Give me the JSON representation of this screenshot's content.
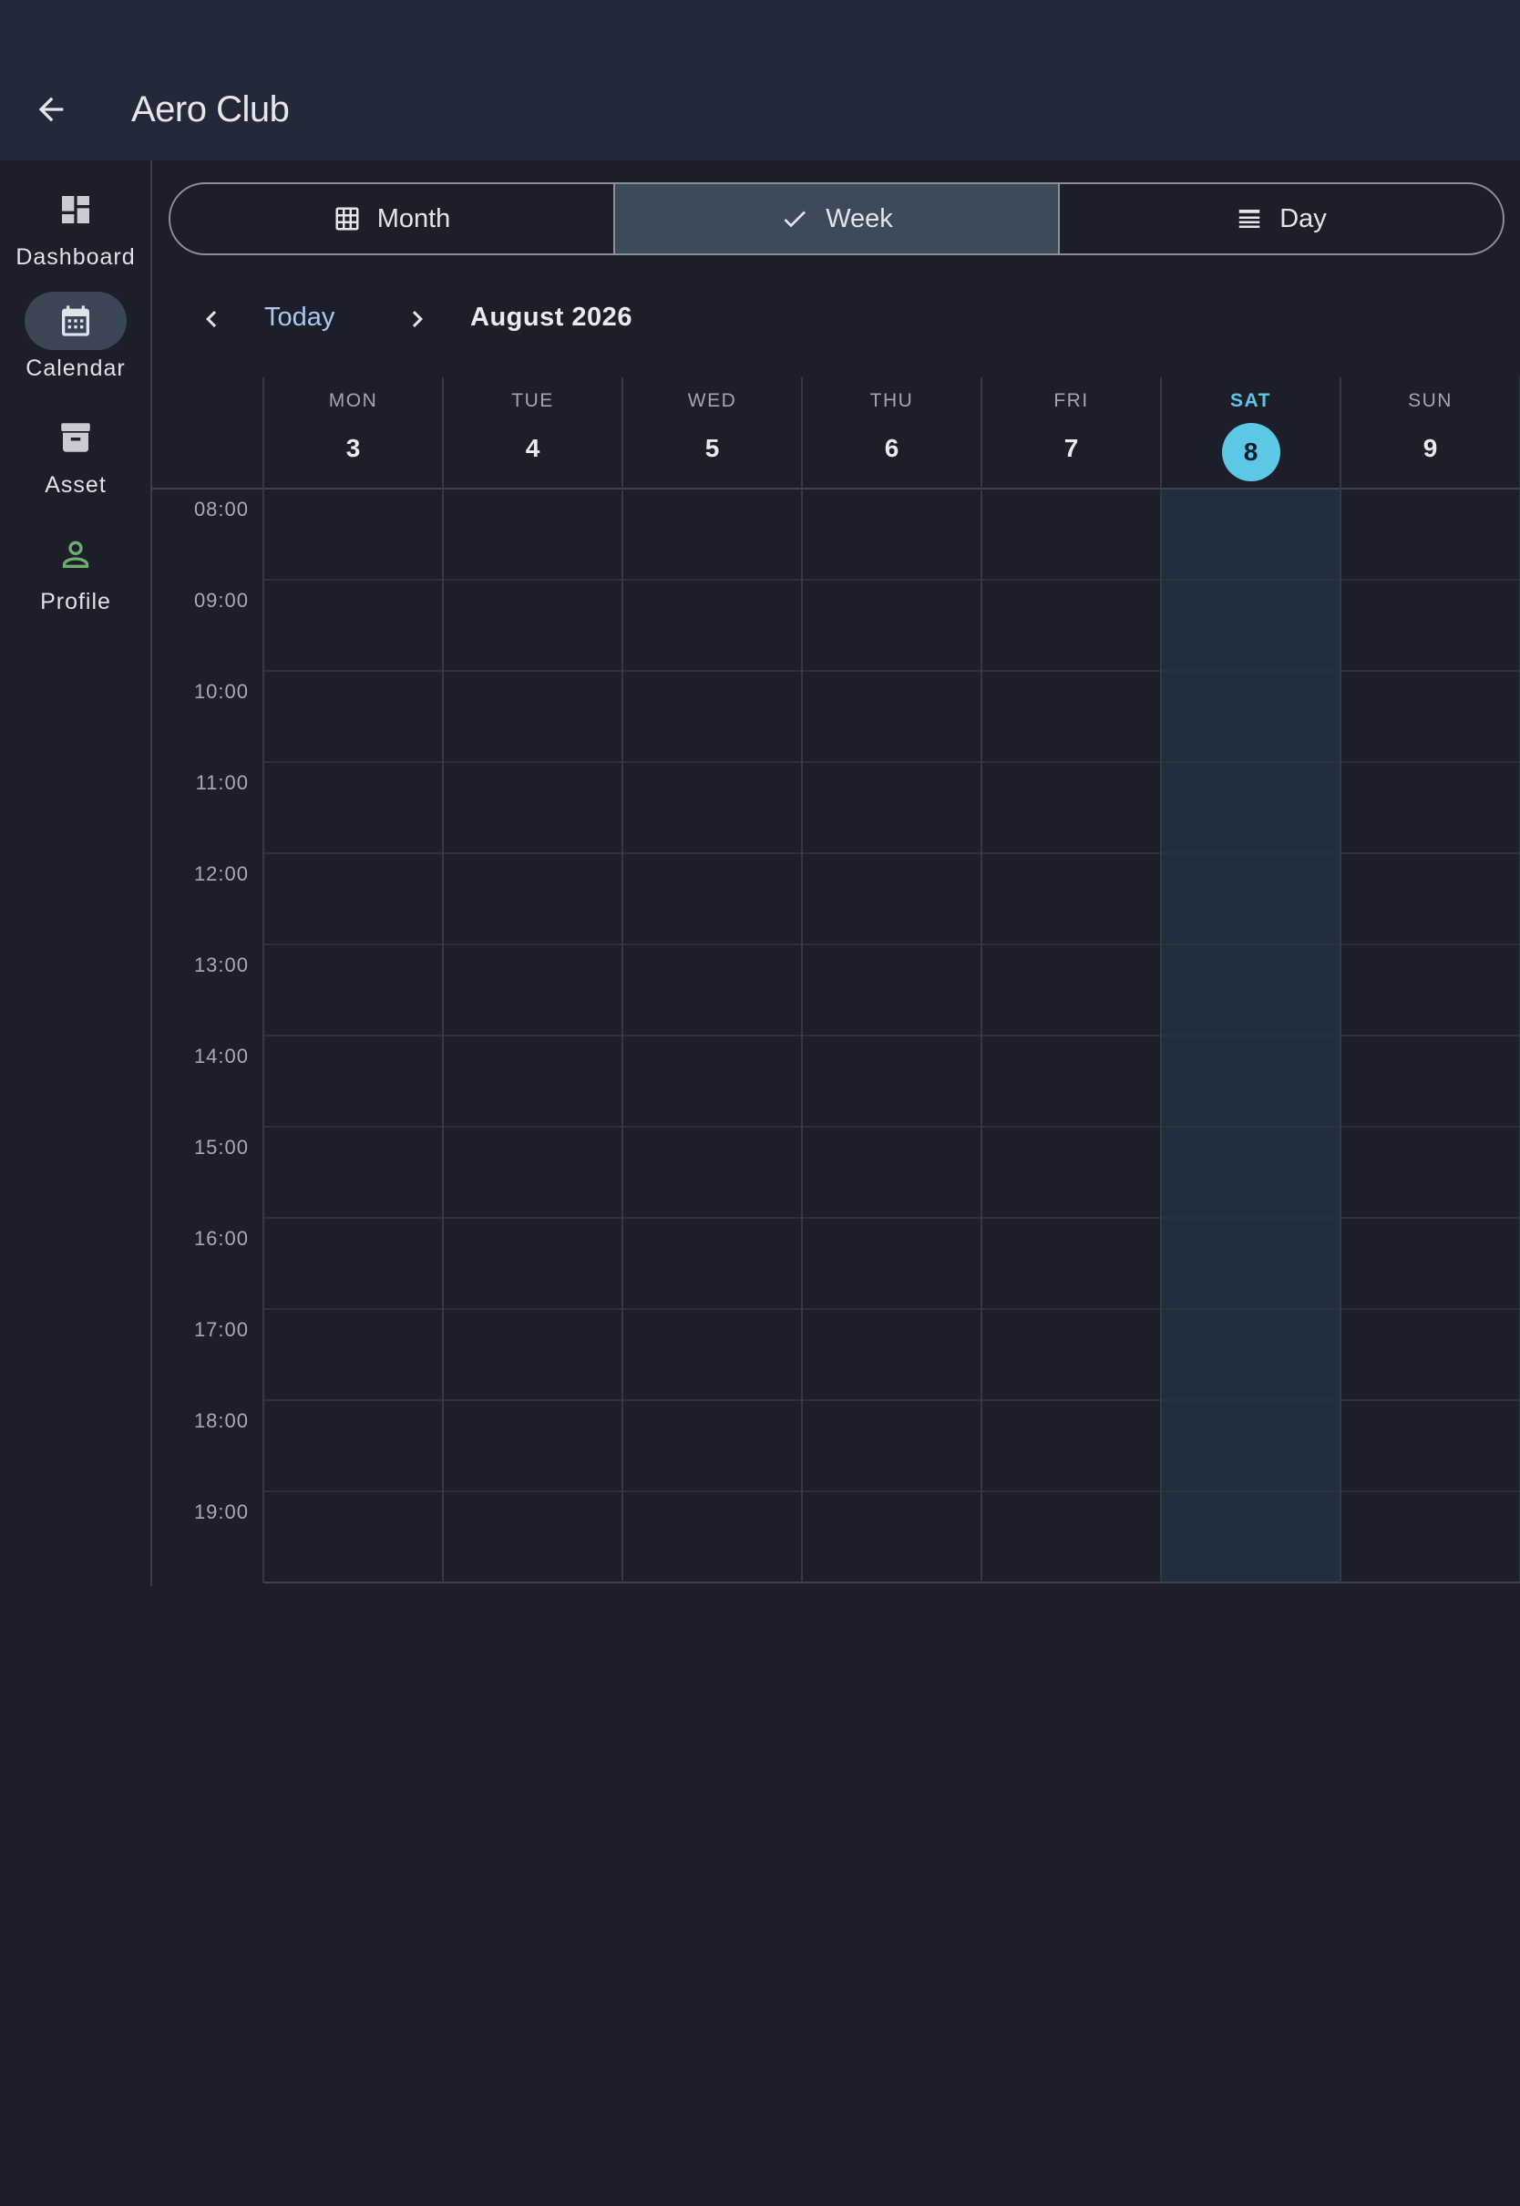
{
  "header": {
    "title": "Aero Club",
    "back_icon": "arrow-left-icon"
  },
  "sidebar": {
    "items": [
      {
        "label": "Dashboard",
        "icon": "dashboard-icon",
        "active": false
      },
      {
        "label": "Calendar",
        "icon": "calendar-icon",
        "active": true
      },
      {
        "label": "Asset",
        "icon": "archive-box-icon",
        "active": false
      },
      {
        "label": "Profile",
        "icon": "person-icon",
        "active": false
      }
    ]
  },
  "view_switcher": {
    "month": {
      "label": "Month",
      "icon": "grid-icon"
    },
    "week": {
      "label": "Week",
      "icon": "check-icon",
      "selected": true
    },
    "day": {
      "label": "Day",
      "icon": "list-lines-icon"
    }
  },
  "date_nav": {
    "today_label": "Today",
    "current_period": "August 2026"
  },
  "week": {
    "days": [
      {
        "dow": "MON",
        "date": "3",
        "today": false
      },
      {
        "dow": "TUE",
        "date": "4",
        "today": false
      },
      {
        "dow": "WED",
        "date": "5",
        "today": false
      },
      {
        "dow": "THU",
        "date": "6",
        "today": false
      },
      {
        "dow": "FRI",
        "date": "7",
        "today": false
      },
      {
        "dow": "SAT",
        "date": "8",
        "today": true
      },
      {
        "dow": "SUN",
        "date": "9",
        "today": false
      }
    ],
    "hours": [
      "08:00",
      "09:00",
      "10:00",
      "11:00",
      "12:00",
      "13:00",
      "14:00",
      "15:00",
      "16:00",
      "17:00",
      "18:00",
      "19:00"
    ]
  },
  "colors": {
    "background": "#1c1f29",
    "topbar": "#232938",
    "accent_today": "#5cc8e6",
    "today_column": "#1f2f3d",
    "segment_selected": "#3d4a5a",
    "profile_icon": "#6aaf6e",
    "link": "#a8c8ef"
  }
}
